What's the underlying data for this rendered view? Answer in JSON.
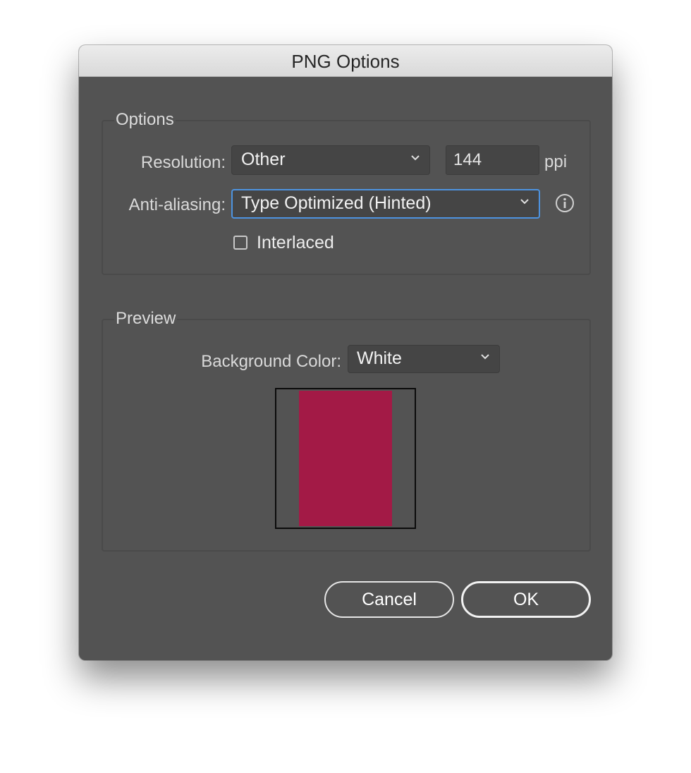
{
  "window": {
    "title": "PNG Options"
  },
  "options_group": {
    "label": "Options",
    "resolution_label": "Resolution:",
    "resolution_select_value": "Other",
    "resolution_field_value": "144",
    "resolution_unit": "ppi",
    "antialiasing_label": "Anti-aliasing:",
    "antialiasing_select_value": "Type Optimized (Hinted)",
    "interlaced_label": "Interlaced",
    "interlaced_checked": false,
    "info_icon": "info-circle-icon"
  },
  "preview_group": {
    "label": "Preview",
    "background_color_label": "Background Color:",
    "background_color_value": "White",
    "page_color": "#a31a46"
  },
  "buttons": {
    "cancel_label": "Cancel",
    "ok_label": "OK"
  },
  "colors": {
    "dialog_bg": "#535353",
    "focus_ring": "#4d93e0"
  }
}
